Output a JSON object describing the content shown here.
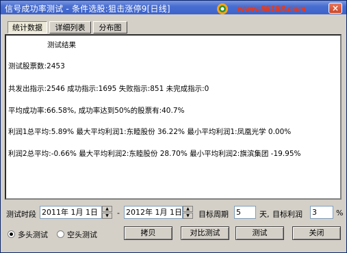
{
  "window": {
    "title": "信号成功率测试 - 条件选股:狙击涨停9[日线]",
    "logo_text": "www.55188.com",
    "close_glyph": "×"
  },
  "tabs": [
    {
      "label": "统计数据",
      "active": true
    },
    {
      "label": "详细列表",
      "active": false
    },
    {
      "label": "分布图",
      "active": false
    }
  ],
  "results": {
    "heading": "测试结果",
    "lines": [
      "测试股票数:2453",
      "共发出指示:2546 成功指示:1695 失败指示:851 未完成指示:0",
      "平均成功率:66.58%, 成功率达到50%的股票有:40.7%",
      "利润1总平均:5.89% 最大平均利润1:东睦股份 36.22% 最小平均利润1:凤凰光学 0.00%",
      "利润2总平均:-0.66% 最大平均利润2:东睦股份 28.70% 最小平均利润2:旗滨集团 -19.95%"
    ]
  },
  "params": {
    "period_label": "测试时段",
    "start_date": "2011年 1月 1日",
    "dash": "-",
    "end_date": "2012年 1月 1日",
    "target_period_label": "目标周期",
    "target_period_value": "5",
    "day_unit": "天,",
    "target_profit_label": "目标利润",
    "target_profit_value": "3",
    "percent": "%"
  },
  "mode": {
    "long_label": "多头测试",
    "short_label": "空头测试",
    "selected": "long"
  },
  "buttons": {
    "copy": "拷贝",
    "compare": "对比测试",
    "test": "测试",
    "close": "关闭"
  }
}
